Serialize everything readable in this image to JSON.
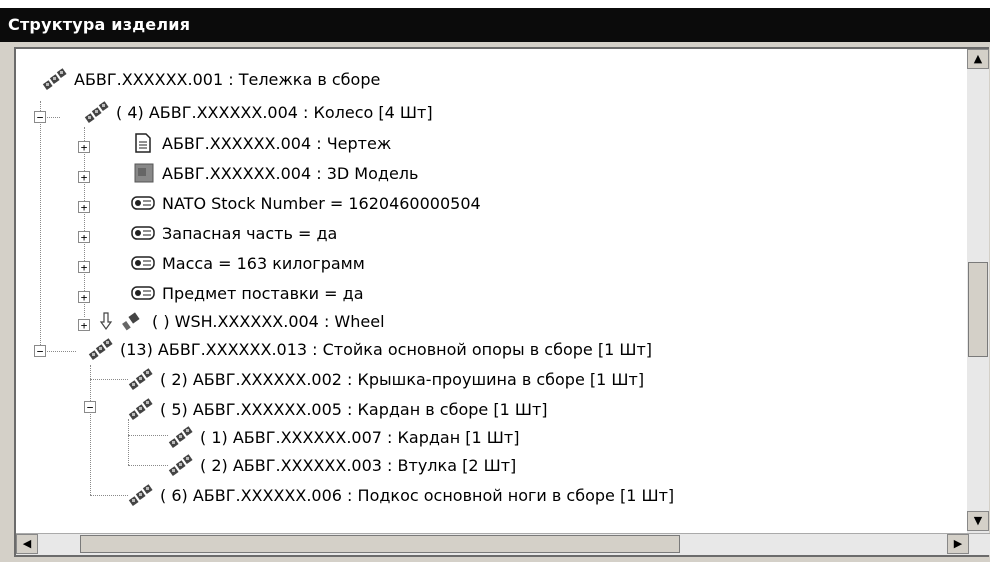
{
  "window": {
    "title": "Структура изделия"
  },
  "tree": {
    "items": [
      {
        "label": "АБВГ.XXXXXX.001 : Тележка в сборе",
        "icon": "assembly-icon"
      },
      {
        "label": "( 4) АБВГ.XXXXXX.004 : Колесо [4 Шт]",
        "icon": "assembly-icon"
      },
      {
        "label": "АБВГ.XXXXXX.004 : Чертеж",
        "icon": "document-icon"
      },
      {
        "label": "АБВГ.XXXXXX.004 : 3D Модель",
        "icon": "model-3d-icon"
      },
      {
        "label": "NATO Stock Number = 1620460000504",
        "icon": "attribute-tag-icon"
      },
      {
        "label": "Запасная часть = да",
        "icon": "attribute-tag-icon"
      },
      {
        "label": "Масса = 163 килограмм",
        "icon": "attribute-tag-icon"
      },
      {
        "label": "Предмет поставки = да",
        "icon": "attribute-tag-icon"
      },
      {
        "label": "( ) WSH.XXXXXX.004 : Wheel",
        "icon": "part-icon"
      },
      {
        "label": "(13) АБВГ.XXXXXX.013 : Стойка основной опоры в сборе [1 Шт]",
        "icon": "assembly-icon"
      },
      {
        "label": "( 2) АБВГ.XXXXXX.002 : Крышка-проушина в сборе [1 Шт]",
        "icon": "assembly-icon"
      },
      {
        "label": "( 5) АБВГ.XXXXXX.005 : Кардан в сборе [1 Шт]",
        "icon": "assembly-icon"
      },
      {
        "label": "( 1) АБВГ.XXXXXX.007 : Кардан [1 Шт]",
        "icon": "assembly-icon"
      },
      {
        "label": "( 2) АБВГ.XXXXXX.003 : Втулка [2 Шт]",
        "icon": "assembly-icon"
      },
      {
        "label": "( 6) АБВГ.XXXXXX.006 : Подкос основной ноги в сборе [1 Шт]",
        "icon": "assembly-icon"
      }
    ]
  },
  "colors": {
    "titlebar": "#0b0b0b",
    "window_bg": "#d4d0c8",
    "tree_bg": "#ffffff"
  }
}
